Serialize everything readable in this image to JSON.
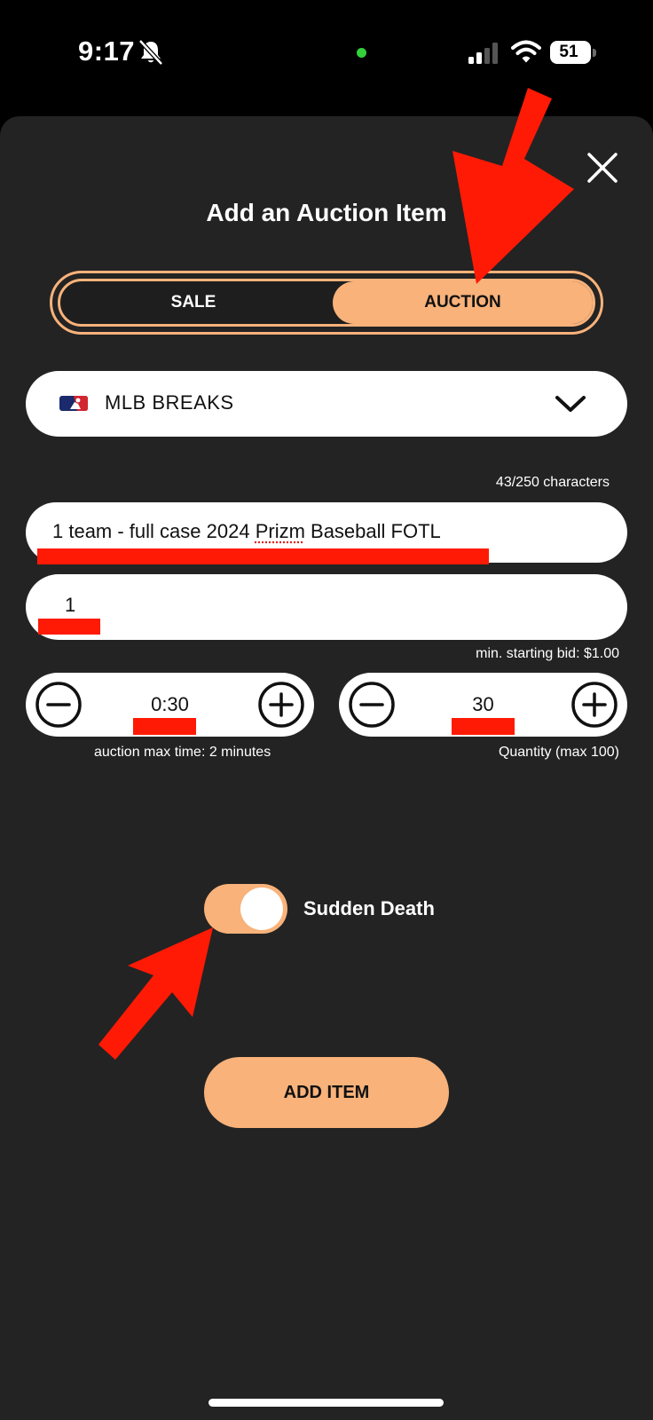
{
  "status_bar": {
    "time": "9:17",
    "battery": "51",
    "icons": [
      "bell-slash-icon",
      "signal-icon",
      "wifi-icon",
      "battery-icon"
    ]
  },
  "modal": {
    "title": "Add an Auction Item",
    "close_icon": "close-icon",
    "mode_toggle": {
      "sale_label": "SALE",
      "auction_label": "AUCTION",
      "selected": "AUCTION"
    },
    "category": {
      "label": "MLB BREAKS",
      "icon": "mlb-logo-icon",
      "dropdown_icon": "chevron-down-icon"
    },
    "title_field": {
      "char_count": "43/250 characters",
      "value_before": "1 team - full case 2024 ",
      "value_flagged": "Prizm",
      "value_after": " Baseball FOTL"
    },
    "bid_field": {
      "value": "1",
      "min_bid_note": "min. starting bid: $1.00"
    },
    "time_stepper": {
      "value": "0:30",
      "caption": "auction max time: 2 minutes"
    },
    "quantity_stepper": {
      "value": "30",
      "caption": "Quantity (max 100)"
    },
    "sudden_death": {
      "label": "Sudden Death",
      "enabled": true
    },
    "submit_label": "ADD ITEM"
  },
  "colors": {
    "accent": "#f8b27a",
    "sheet_background": "#232323",
    "annotation_red": "#ff1a05"
  }
}
